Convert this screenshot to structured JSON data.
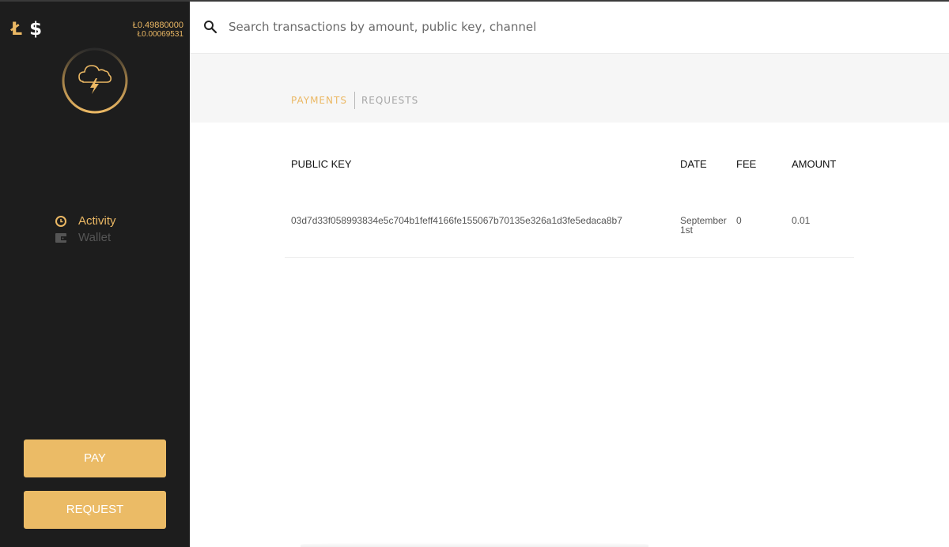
{
  "sidebar": {
    "currency": {
      "ltc_symbol": "Ł",
      "usd_symbol": "$"
    },
    "balances": {
      "primary": "Ł0.49880000",
      "secondary": "Ł0.00069531"
    },
    "nav": [
      {
        "label": "Activity",
        "icon": "clock-icon",
        "active": true
      },
      {
        "label": "Wallet",
        "icon": "wallet-icon",
        "active": false
      }
    ],
    "buttons": {
      "pay": "PAY",
      "request": "REQUEST"
    }
  },
  "search": {
    "placeholder": "Search transactions by amount, public key, channel",
    "value": ""
  },
  "tabs": [
    {
      "label": "PAYMENTS",
      "active": true
    },
    {
      "label": "REQUESTS",
      "active": false
    }
  ],
  "table": {
    "headers": {
      "public_key": "PUBLIC KEY",
      "date": "DATE",
      "fee": "FEE",
      "amount": "AMOUNT"
    },
    "rows": [
      {
        "public_key": "03d7d33f058993834e5c704b1feff4166fe155067b70135e326a1d3fe5edaca8b7",
        "date": "September 1st",
        "fee": "0",
        "amount": "0.01"
      }
    ]
  },
  "colors": {
    "accent": "#ebb864",
    "sidebar_bg": "#1d1d1d",
    "button_bg": "#ebbb66"
  }
}
